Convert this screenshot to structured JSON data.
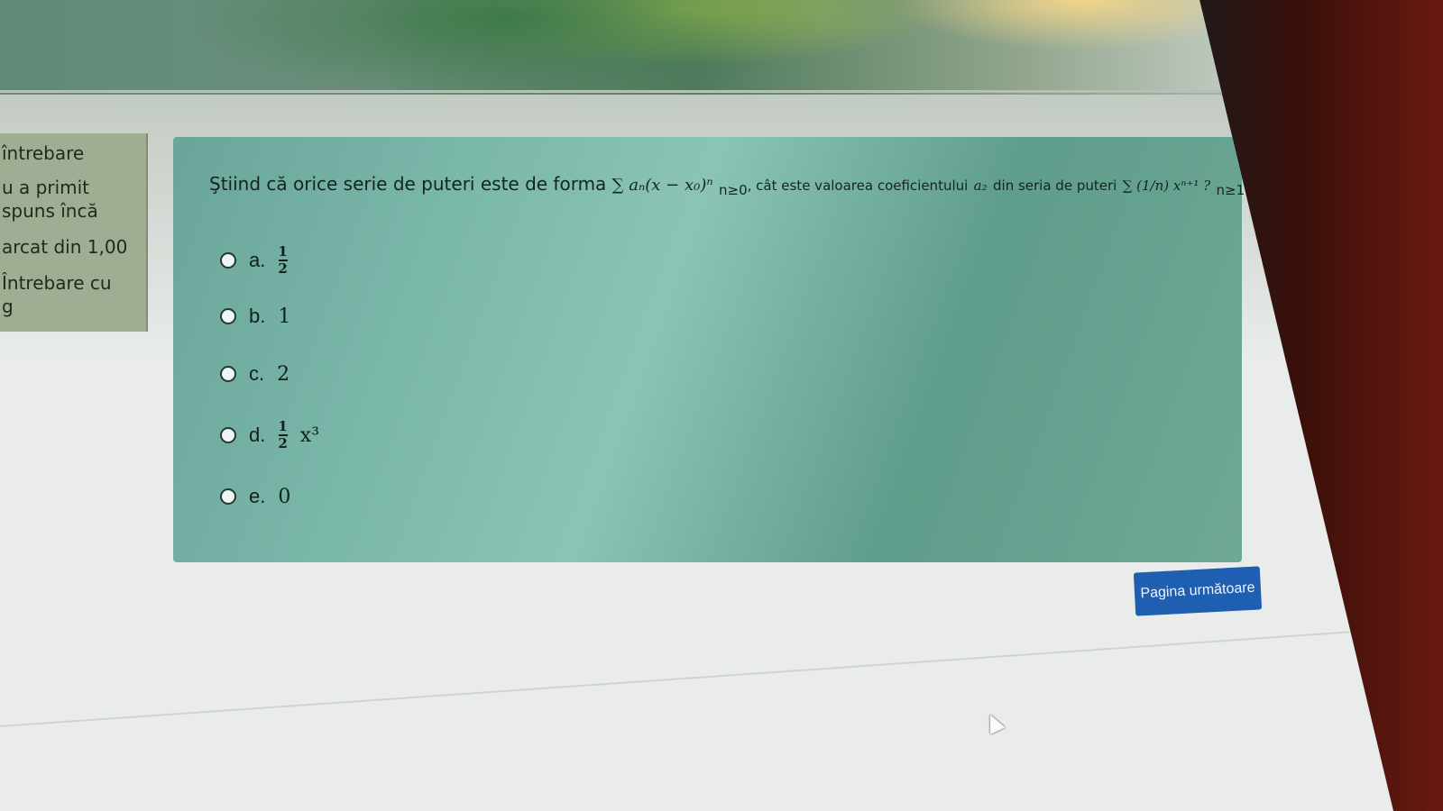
{
  "sidebar_info": {
    "line1": "întrebare",
    "line2": "u a primit",
    "line3": "spuns încă",
    "line4": "arcat din 1,00",
    "line5": "Întrebare cu",
    "line6": "g"
  },
  "question": {
    "prefix": "Ştiind că orice serie de puteri este de forma",
    "series_form": "∑ aₙ(x − x₀)ⁿ",
    "series_index": "n≥0",
    "middle": ", cât este valoarea coeficientului",
    "coef": "a₂",
    "suffix": "din seria de puteri",
    "tail_series": "∑ (1/n) xⁿ⁺¹ ?",
    "tail_index": "n≥1"
  },
  "answers": [
    {
      "letter": "a.",
      "num": "1",
      "den": "2",
      "value": ""
    },
    {
      "letter": "b.",
      "num": "",
      "den": "",
      "value": "1"
    },
    {
      "letter": "c.",
      "num": "",
      "den": "",
      "value": "2"
    },
    {
      "letter": "d.",
      "num": "1",
      "den": "2",
      "value": "x³"
    },
    {
      "letter": "e.",
      "num": "",
      "den": "",
      "value": "0"
    }
  ],
  "next_button": "Pagina următoare",
  "colors": {
    "card": "#7ab8aa",
    "button": "#1f5fb1",
    "sidebar": "#9fae92"
  }
}
